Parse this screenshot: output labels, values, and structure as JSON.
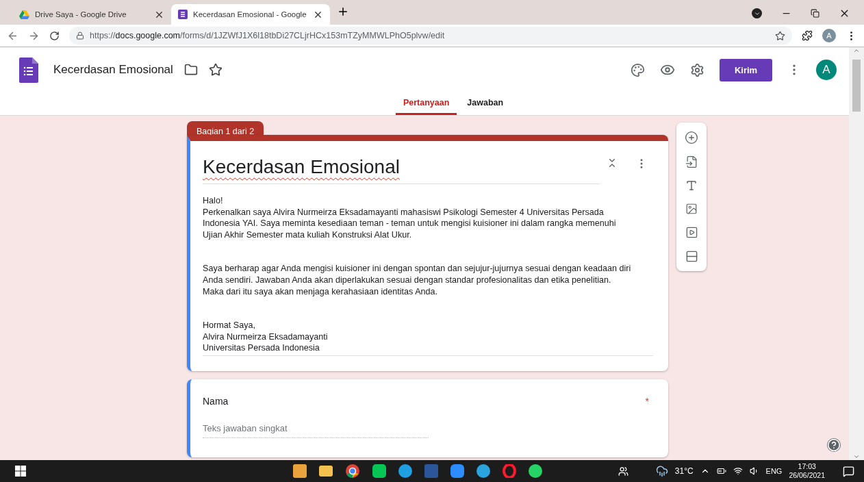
{
  "browser": {
    "tabs": [
      {
        "title": "Drive Saya - Google Drive",
        "selected": false,
        "kind": "drive"
      },
      {
        "title": "Kecerdasan Emosional - Google",
        "selected": true,
        "kind": "forms"
      }
    ],
    "url": {
      "scheme": "https://",
      "domain": "docs.google.com",
      "path": "/forms/d/1JZWfJ1X6l18tbDi27CLjrHCx153mTZyMMWLPhO5plvw/edit"
    },
    "profile_initial": "A"
  },
  "form_header": {
    "title": "Kecerdasan Emosional",
    "send_button": "Kirim",
    "avatar_initial": "A",
    "tabs": [
      {
        "label": "Pertanyaan",
        "selected": true
      },
      {
        "label": "Jawaban",
        "selected": false
      }
    ]
  },
  "section": {
    "badge": "Bagian 1 dari 2",
    "title": "Kecerdasan Emosional",
    "paragraphs": [
      [
        "Halo!",
        "Perkenalkan saya Alvira Nurmeirza Eksadamayanti mahasiswi Psikologi Semester 4 Universitas Persada",
        "Indonesia YAI. Saya meminta kesediaan teman - teman untuk mengisi kuisioner ini dalam rangka memenuhi",
        "Ujian Akhir Semester mata kuliah Konstruksi Alat Ukur."
      ],
      [
        "Saya berharap agar Anda mengisi kuisioner ini dengan spontan dan sejujur-jujurnya sesuai dengan keadaan diri",
        "Anda sendiri. Jawaban Anda akan diperlakukan sesuai dengan standar profesionalitas dan etika penelitian.",
        "Maka dari itu saya akan menjaga kerahasiaan identitas Anda."
      ],
      [
        "Hormat Saya,",
        "Alvira Nurmeirza Eksadamayanti",
        "Universitas Persada Indonesia"
      ]
    ]
  },
  "questions": [
    {
      "title": "Nama",
      "required": true,
      "required_mark": "*",
      "placeholder": "Teks jawaban singkat"
    }
  ],
  "taskbar": {
    "temperature": "31°C",
    "language": "ENG",
    "time": "17:03",
    "date": "26/06/2021"
  }
}
